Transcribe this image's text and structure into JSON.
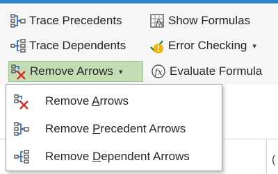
{
  "ribbon": {
    "formula_auditing": {
      "trace_precedents": {
        "label": "Trace Precedents",
        "icon": "trace-precedents-icon"
      },
      "trace_dependents": {
        "label": "Trace Dependents",
        "icon": "trace-dependents-icon"
      },
      "remove_arrows": {
        "label_pre": "Remove Arrows",
        "icon": "remove-arrows-icon",
        "caret": "▾",
        "state": "pressed"
      },
      "show_formulas": {
        "label": "Show Formulas",
        "icon": "show-formulas-icon"
      },
      "error_checking": {
        "label": "Error Checking",
        "icon": "error-checking-icon",
        "caret": "▾"
      },
      "evaluate_formula": {
        "label": "Evaluate Formula",
        "icon": "evaluate-formula-icon"
      }
    }
  },
  "menu": {
    "items": [
      {
        "pre": "Remove ",
        "accel": "A",
        "post": "rrows",
        "icon": "remove-arrows-icon"
      },
      {
        "pre": "Remove ",
        "accel": "P",
        "post": "recedent Arrows",
        "icon": "trace-precedents-icon"
      },
      {
        "pre": "Remove ",
        "accel": "D",
        "post": "ependent Arrows",
        "icon": "trace-dependents-icon"
      }
    ]
  },
  "sheet": {
    "partial_cell_text": "("
  },
  "colors": {
    "accent": "#2b86c9",
    "pressed_bg": "#c5ddb5",
    "arrow_blue": "#1f5fbf",
    "remove_red": "#d62d20",
    "warning_yellow": "#f4b400"
  }
}
